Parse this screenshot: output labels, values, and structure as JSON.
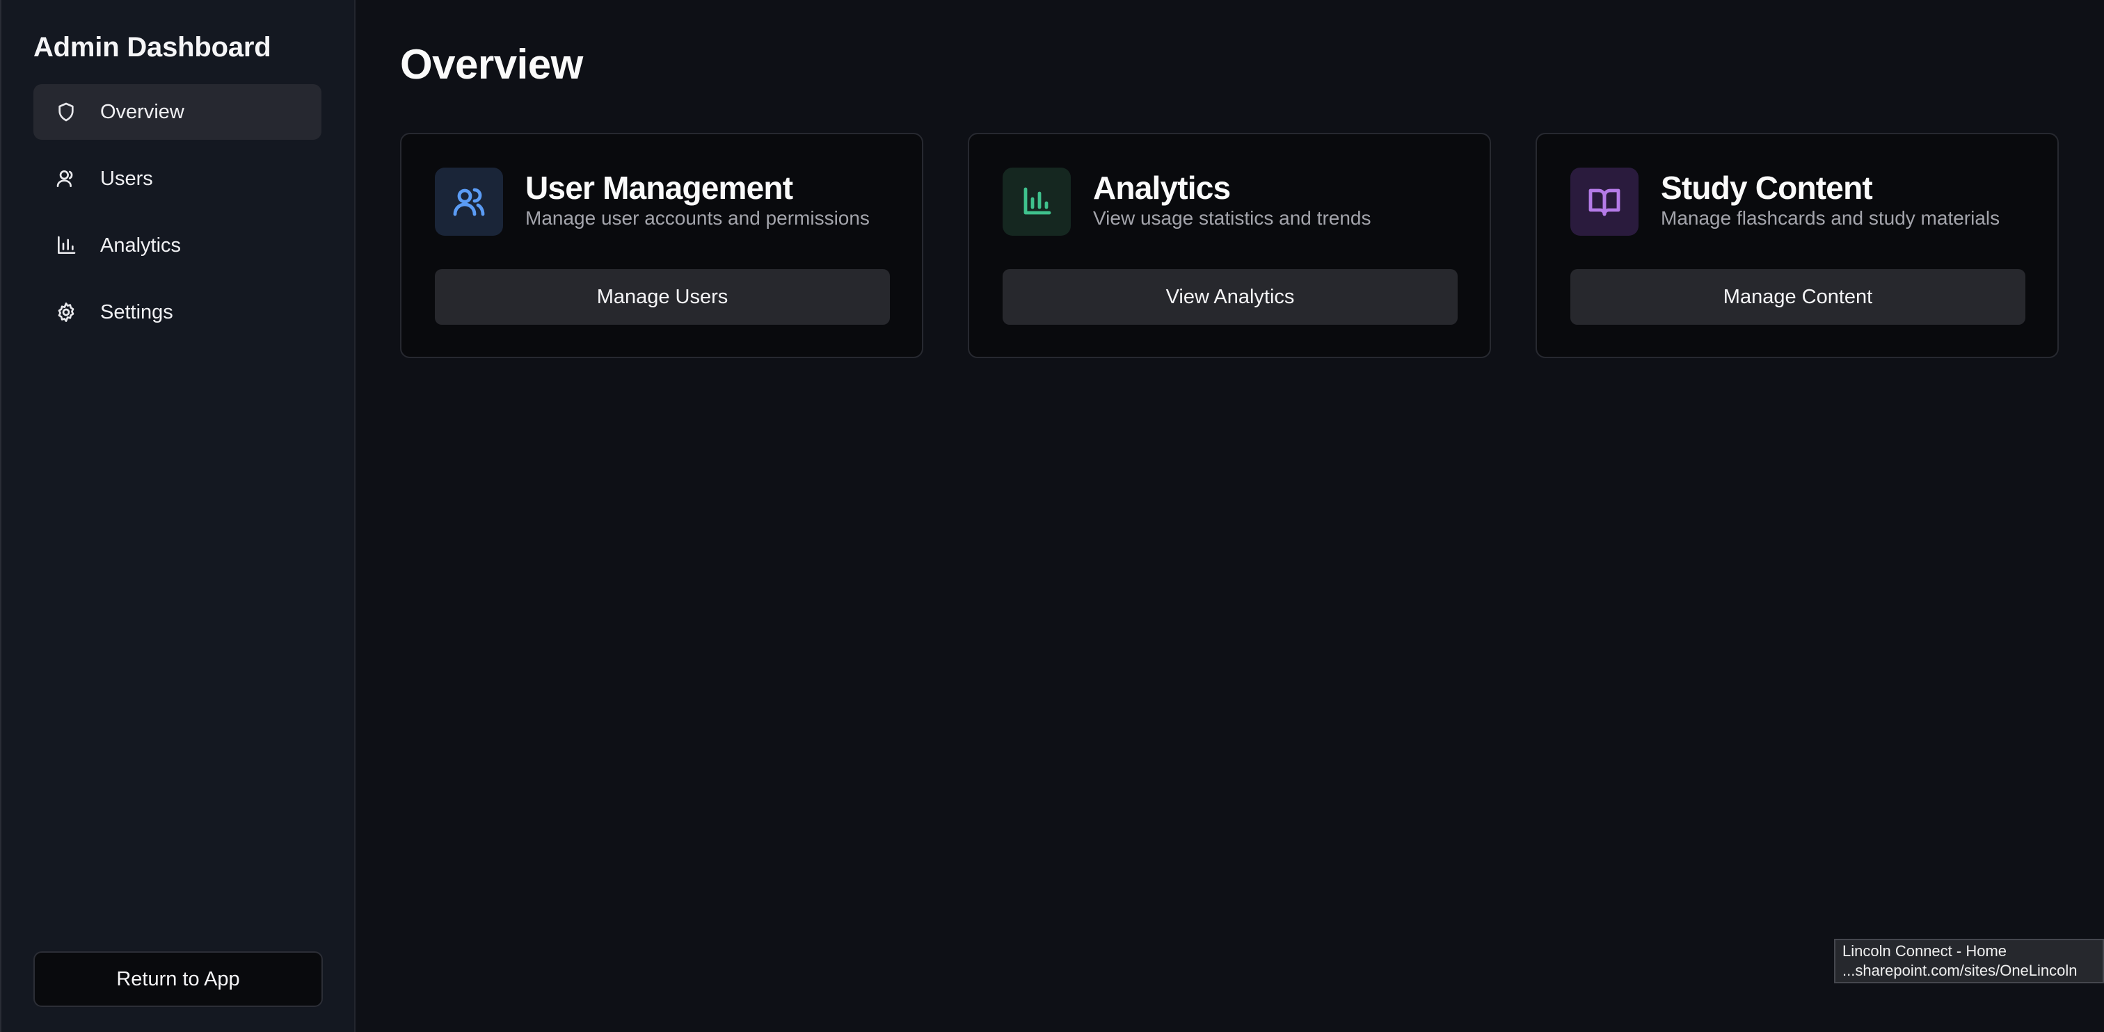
{
  "sidebar": {
    "title": "Admin Dashboard",
    "items": [
      {
        "label": "Overview",
        "icon": "shield-icon",
        "active": true
      },
      {
        "label": "Users",
        "icon": "user-icon",
        "active": false
      },
      {
        "label": "Analytics",
        "icon": "bar-chart-icon",
        "active": false
      },
      {
        "label": "Settings",
        "icon": "gear-icon",
        "active": false
      }
    ],
    "return_label": "Return to App"
  },
  "main": {
    "title": "Overview",
    "cards": [
      {
        "title": "User Management",
        "description": "Manage user accounts and permissions",
        "button": "Manage Users",
        "icon": "users-icon",
        "icon_color": "#5b9cf5",
        "icon_bg": "#1a2538"
      },
      {
        "title": "Analytics",
        "description": "View usage statistics and trends",
        "button": "View Analytics",
        "icon": "bar-chart-icon",
        "icon_color": "#3fc28d",
        "icon_bg": "#152720"
      },
      {
        "title": "Study Content",
        "description": "Manage flashcards and study materials",
        "button": "Manage Content",
        "icon": "book-open-icon",
        "icon_color": "#b57be8",
        "icon_bg": "#2a1b3d"
      }
    ]
  },
  "tooltip": {
    "title": "Lincoln Connect - Home",
    "url": "...sharepoint.com/sites/OneLincoln"
  }
}
